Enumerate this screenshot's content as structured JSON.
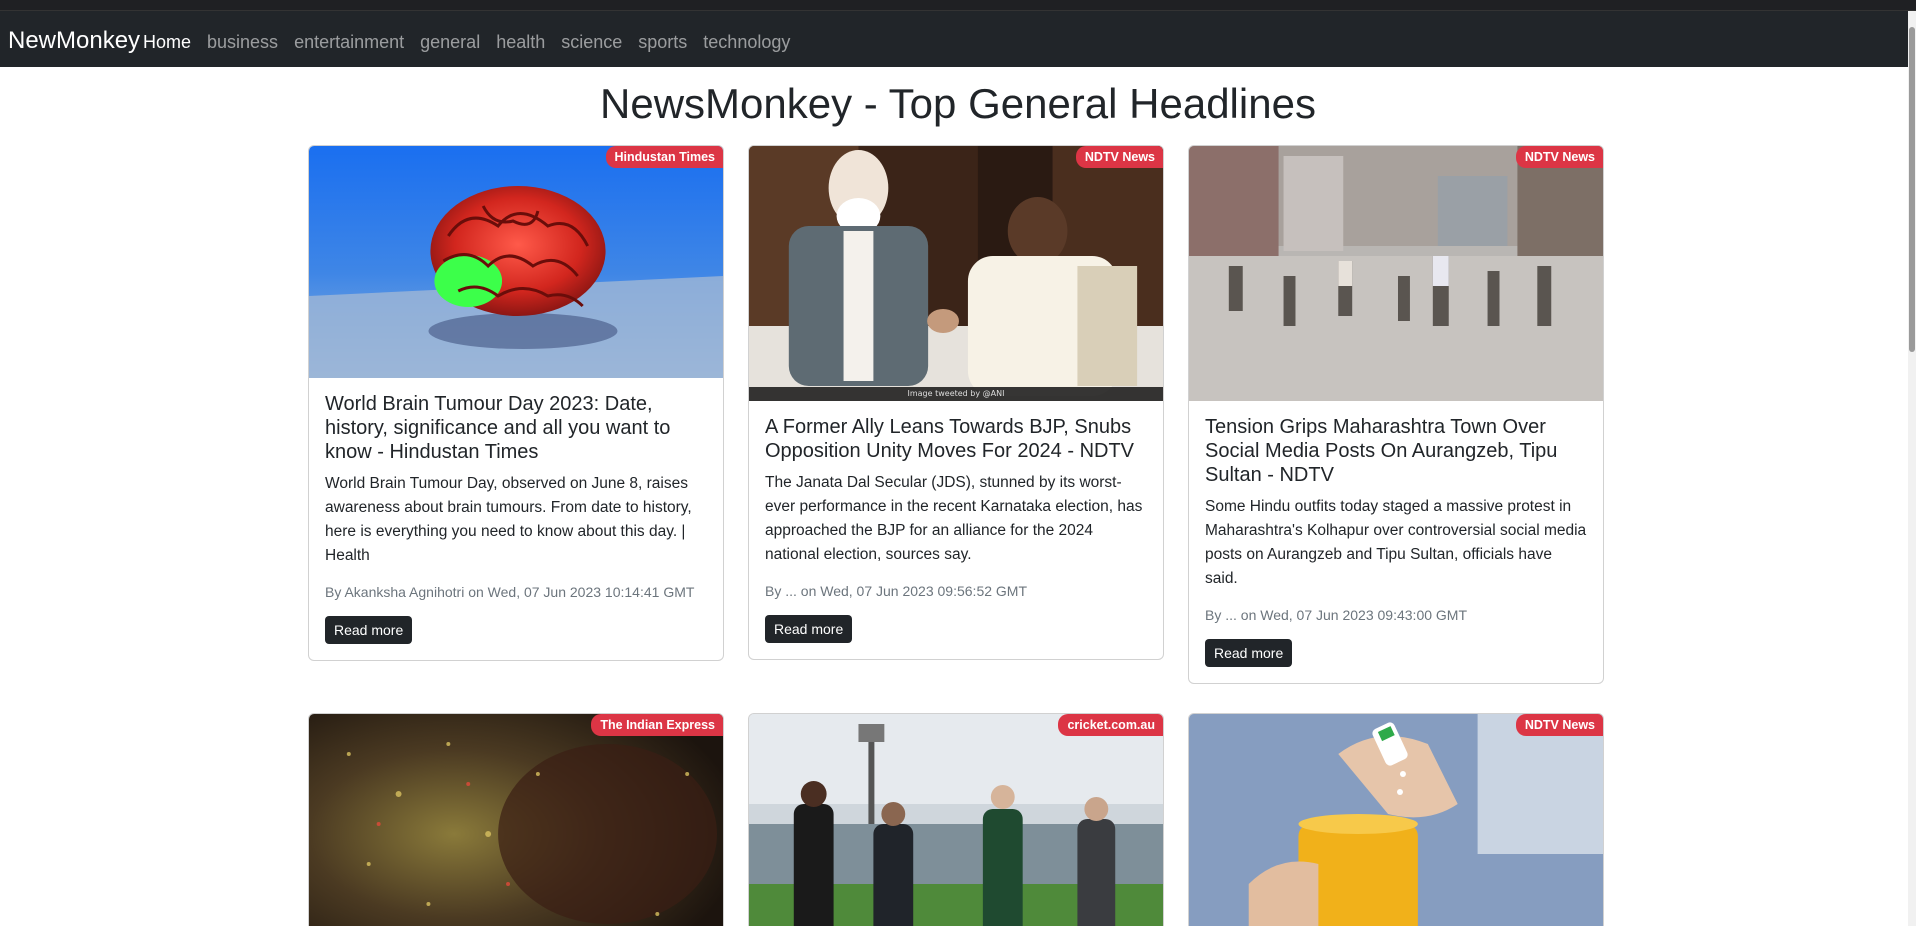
{
  "navbar": {
    "brand": "NewMonkey",
    "links": [
      "Home",
      "business",
      "entertainment",
      "general",
      "health",
      "science",
      "sports",
      "technology"
    ]
  },
  "page_title": "NewsMonkey - Top General Headlines",
  "articles": [
    {
      "source": "Hindustan Times",
      "title": "World Brain Tumour Day 2023: Date, history, significance and all you want to know - Hindustan Times",
      "description": "World Brain Tumour Day, observed on June 8, raises awareness about brain tumours. From date to history, here is everything you need to know about this day. | Health",
      "meta": "By Akanksha Agnihotri on Wed, 07 Jun 2023 10:14:41 GMT",
      "button": "Read more",
      "image_icon": "brain-image"
    },
    {
      "source": "NDTV News",
      "title": "A Former Ally Leans Towards BJP, Snubs Opposition Unity Moves For 2024 - NDTV",
      "description": "The Janata Dal Secular (JDS), stunned by its worst-ever performance in the recent Karnataka election, has approached the BJP for an alliance for the 2024 national election, sources say.",
      "meta": "By ... on Wed, 07 Jun 2023 09:56:52 GMT",
      "button": "Read more",
      "image_caption": "Image tweeted by @ANI",
      "image_icon": "leaders-meeting-image"
    },
    {
      "source": "NDTV News",
      "title": "Tension Grips Maharashtra Town Over Social Media Posts On Aurangzeb, Tipu Sultan - NDTV",
      "description": "Some Hindu outfits today staged a massive protest in Maharashtra's Kolhapur over controversial social media posts on Aurangzeb and Tipu Sultan, officials have said.",
      "meta": "By ... on Wed, 07 Jun 2023 09:43:00 GMT",
      "button": "Read more",
      "image_icon": "street-protest-image"
    },
    {
      "source": "The Indian Express",
      "image_icon": "galaxy-image"
    },
    {
      "source": "cricket.com.au",
      "image_icon": "cricket-toss-image"
    },
    {
      "source": "NDTV News",
      "image_icon": "sweetener-cup-image"
    }
  ],
  "colors": {
    "navbar_bg": "#212529",
    "badge_bg": "#dc3545",
    "button_bg": "#212529"
  }
}
